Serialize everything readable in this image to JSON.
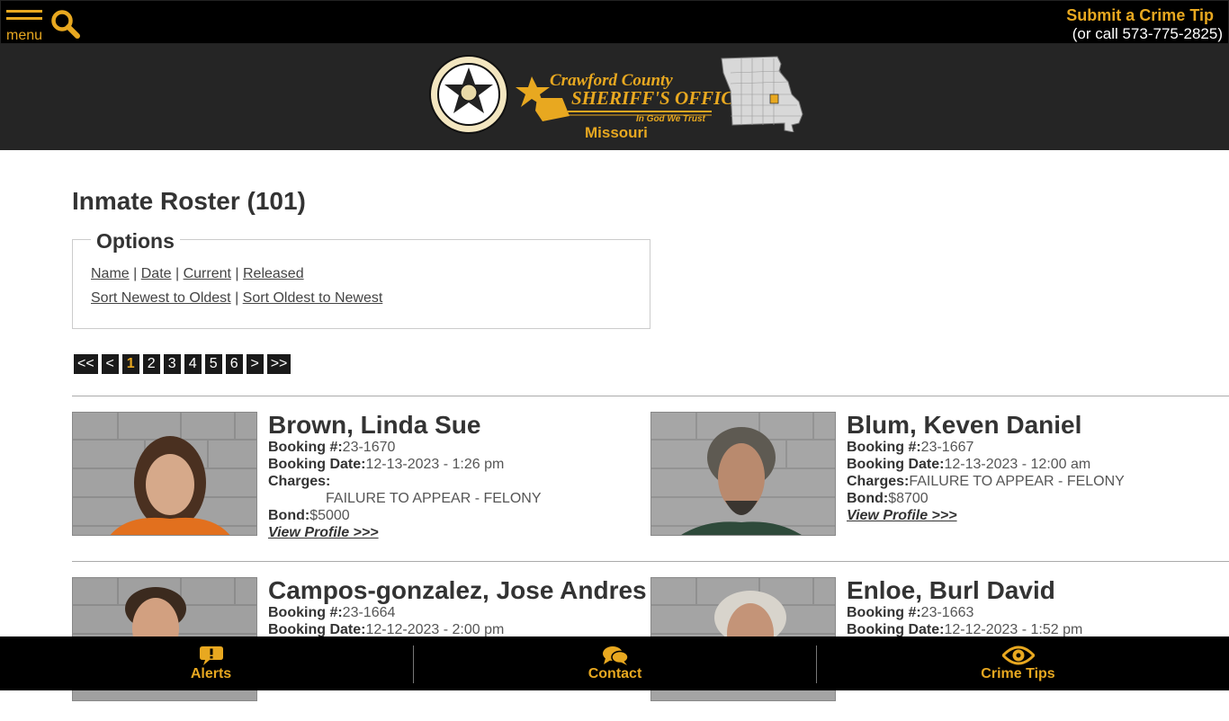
{
  "header": {
    "menu_label": "menu",
    "tip_title": "Submit a Crime Tip",
    "tip_phone": "(or call 573-775-2825)"
  },
  "banner": {
    "logo_line1": "Crawford County",
    "logo_line2": "SHERIFF'S OFFICE",
    "logo_line3": "In God We Trust",
    "state": "Missouri"
  },
  "page": {
    "title": "Inmate Roster (101)"
  },
  "options": {
    "legend": "Options",
    "filters": [
      "Name",
      "Date",
      "Current",
      "Released"
    ],
    "sort": [
      "Sort Newest to Oldest",
      "Sort Oldest to Newest"
    ],
    "separator": " | "
  },
  "pager": {
    "items": [
      "<<",
      "<",
      "1",
      "2",
      "3",
      "4",
      "5",
      "6",
      ">",
      ">>"
    ],
    "active": "1"
  },
  "labels": {
    "booking_num": "Booking #:",
    "booking_date": "Booking Date:",
    "charges": "Charges:",
    "bond": "Bond:",
    "view_profile": "View Profile >>>"
  },
  "inmates": [
    {
      "name": "Brown, Linda Sue",
      "booking_num": "23-1670",
      "booking_date": "12-13-2023 - 1:26 pm",
      "charges": "FAILURE TO APPEAR - FELONY",
      "bond": "$5000"
    },
    {
      "name": "Blum, Keven Daniel",
      "booking_num": "23-1667",
      "booking_date": "12-13-2023 - 12:00 am",
      "charges": "FAILURE TO APPEAR - FELONY",
      "bond": "$8700"
    },
    {
      "name": "Campos-gonzalez, Jose Andres",
      "booking_num": "23-1664",
      "booking_date": "12-12-2023 - 2:00 pm"
    },
    {
      "name": "Enloe, Burl David",
      "booking_num": "23-1663",
      "booking_date": "12-12-2023 - 1:52 pm"
    }
  ],
  "bottom_nav": {
    "alerts": "Alerts",
    "contact": "Contact",
    "crime_tips": "Crime Tips"
  },
  "colors": {
    "accent": "#e8a820",
    "bar": "#000000",
    "banner": "#252525"
  }
}
